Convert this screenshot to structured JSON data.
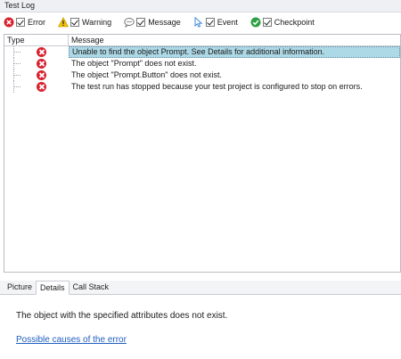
{
  "panel": {
    "title": "Test Log"
  },
  "filters": [
    {
      "label": "Error",
      "icon": "error-icon",
      "checked": true
    },
    {
      "label": "Warning",
      "icon": "warning-icon",
      "checked": true
    },
    {
      "label": "Message",
      "icon": "message-icon",
      "checked": true
    },
    {
      "label": "Event",
      "icon": "event-icon",
      "checked": true
    },
    {
      "label": "Checkpoint",
      "icon": "checkpoint-icon",
      "checked": true
    }
  ],
  "grid": {
    "columns": {
      "type": "Type",
      "message": "Message"
    },
    "rows": [
      {
        "type": "error",
        "message": "Unable to find the object Prompt. See Details for additional information.",
        "selected": true
      },
      {
        "type": "error",
        "message": "The object \"Prompt\" does not exist.",
        "selected": false
      },
      {
        "type": "error",
        "message": "The object \"Prompt.Button\" does not exist.",
        "selected": false
      },
      {
        "type": "error",
        "message": "The test run has stopped because your test project is configured to stop on errors.",
        "selected": false
      }
    ]
  },
  "tabs": [
    {
      "label": "Picture",
      "active": false
    },
    {
      "label": "Details",
      "active": true
    },
    {
      "label": "Call Stack",
      "active": false
    }
  ],
  "details": {
    "text": "The object with the specified attributes does not exist.",
    "link": "Possible causes of the error"
  },
  "colors": {
    "error": "#d8202e",
    "selected_row": "#add8e6",
    "link": "#1f5fbf",
    "warning": "#f5c400",
    "checkpoint": "#2ea043"
  }
}
